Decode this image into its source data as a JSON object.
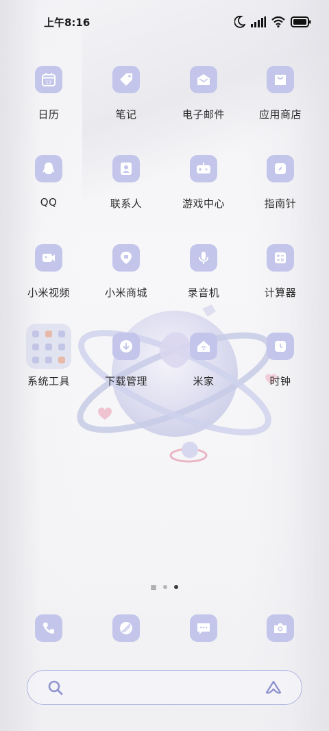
{
  "status_bar": {
    "time": "上午8:16",
    "icons": [
      "moon-icon",
      "signal-icon",
      "wifi-icon",
      "battery-icon"
    ]
  },
  "apps": [
    {
      "label": "日历",
      "icon": "calendar-icon",
      "calendar_day": "12"
    },
    {
      "label": "笔记",
      "icon": "notes-tag-icon"
    },
    {
      "label": "电子邮件",
      "icon": "mail-icon"
    },
    {
      "label": "应用商店",
      "icon": "store-bag-icon"
    },
    {
      "label": "QQ",
      "icon": "qq-penguin-icon"
    },
    {
      "label": "联系人",
      "icon": "contact-icon"
    },
    {
      "label": "游戏中心",
      "icon": "gamepad-icon"
    },
    {
      "label": "指南针",
      "icon": "compass-icon"
    },
    {
      "label": "小米视频",
      "icon": "video-camera-icon"
    },
    {
      "label": "小米商城",
      "icon": "mi-store-icon"
    },
    {
      "label": "录音机",
      "icon": "microphone-icon"
    },
    {
      "label": "计算器",
      "icon": "calculator-icon"
    },
    {
      "label": "系统工具",
      "icon": "folder-icon"
    },
    {
      "label": "下载管理",
      "icon": "download-icon"
    },
    {
      "label": "米家",
      "icon": "mi-home-icon"
    },
    {
      "label": "时钟",
      "icon": "clock-icon"
    }
  ],
  "page_indicator": {
    "pages": 2,
    "current": 2
  },
  "dock": [
    {
      "icon": "phone-icon"
    },
    {
      "icon": "browser-icon"
    },
    {
      "icon": "messages-icon"
    },
    {
      "icon": "camera-icon"
    }
  ],
  "search_bar": {
    "search_icon": "search-icon",
    "assistant_icon": "assistant-icon"
  },
  "colors": {
    "icon_bg": "#c3c6ea",
    "glyph": "#ffffff",
    "search_border": "#aeb2e0",
    "text": "#2a2a2a"
  }
}
